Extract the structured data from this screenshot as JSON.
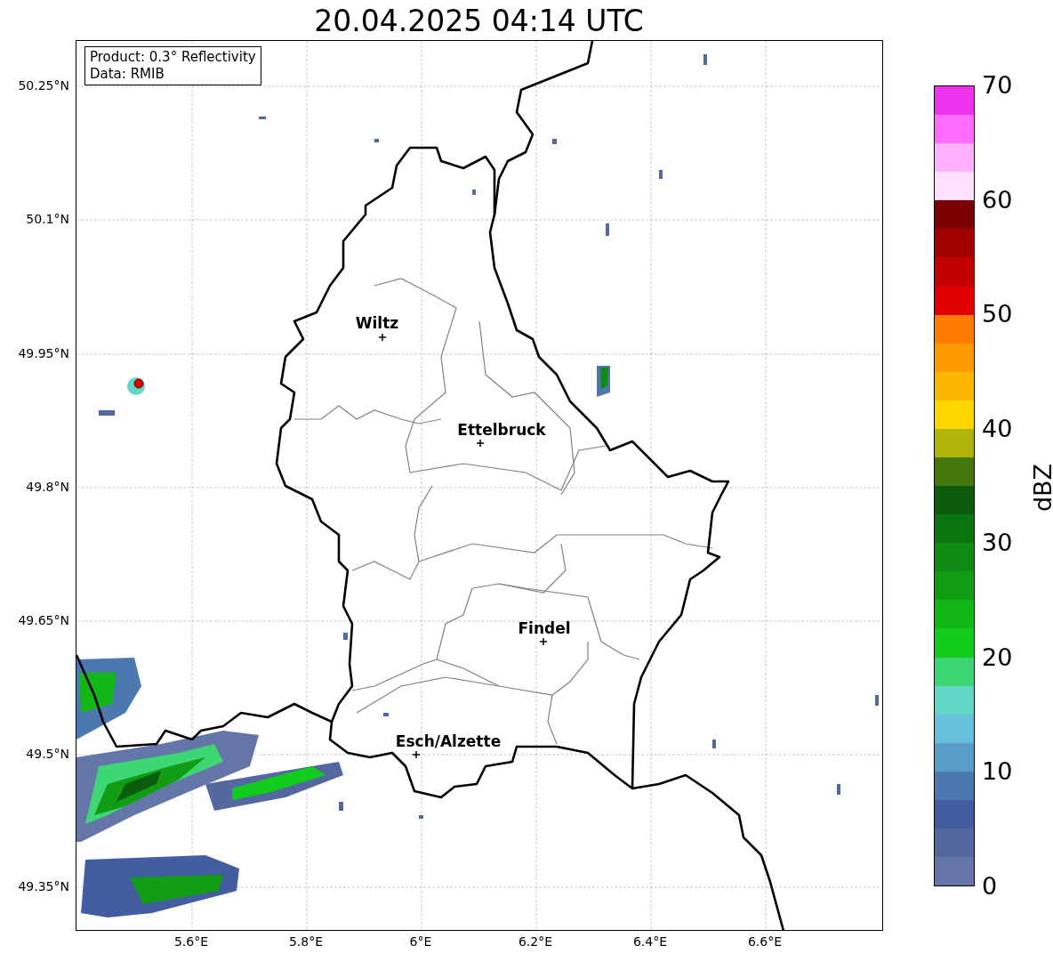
{
  "title": "20.04.2025 04:14 UTC",
  "info_box": [
    "Product: 0.3° Reflectivity",
    "Data: RMIB"
  ],
  "y_ticks": [
    "50.25°N",
    "50.1°N",
    "49.95°N",
    "49.8°N",
    "49.65°N",
    "49.5°N",
    "49.35°N"
  ],
  "x_ticks": [
    "5.6°E",
    "5.8°E",
    "6°E",
    "6.2°E",
    "6.4°E",
    "6.6°E"
  ],
  "cities": [
    {
      "name": "Wiltz"
    },
    {
      "name": "Ettelbruck"
    },
    {
      "name": "Findel"
    },
    {
      "name": "Esch/Alzette"
    }
  ],
  "colorbar": {
    "label": "dBZ",
    "ticks": [
      "70",
      "60",
      "50",
      "40",
      "30",
      "20",
      "10",
      "0"
    ],
    "bins": [
      {
        "color": "#ee32ee"
      },
      {
        "color": "#ff6cff"
      },
      {
        "color": "#ffb0ff"
      },
      {
        "color": "#ffe0ff"
      },
      {
        "color": "#7c0000"
      },
      {
        "color": "#a20000"
      },
      {
        "color": "#c20000"
      },
      {
        "color": "#e00000"
      },
      {
        "color": "#ff7c00"
      },
      {
        "color": "#ff9a00"
      },
      {
        "color": "#feb700"
      },
      {
        "color": "#fed700"
      },
      {
        "color": "#b0b409"
      },
      {
        "color": "#44760b"
      },
      {
        "color": "#0a5b0c"
      },
      {
        "color": "#0b7410"
      },
      {
        "color": "#0f8a12"
      },
      {
        "color": "#109c14"
      },
      {
        "color": "#12b716"
      },
      {
        "color": "#12cd1b"
      },
      {
        "color": "#3ed675"
      },
      {
        "color": "#62d7c6"
      },
      {
        "color": "#67c1dd"
      },
      {
        "color": "#5a9cc8"
      },
      {
        "color": "#4b78ae"
      },
      {
        "color": "#435da0"
      },
      {
        "color": "#53689e"
      },
      {
        "color": "#6475a8"
      }
    ]
  }
}
